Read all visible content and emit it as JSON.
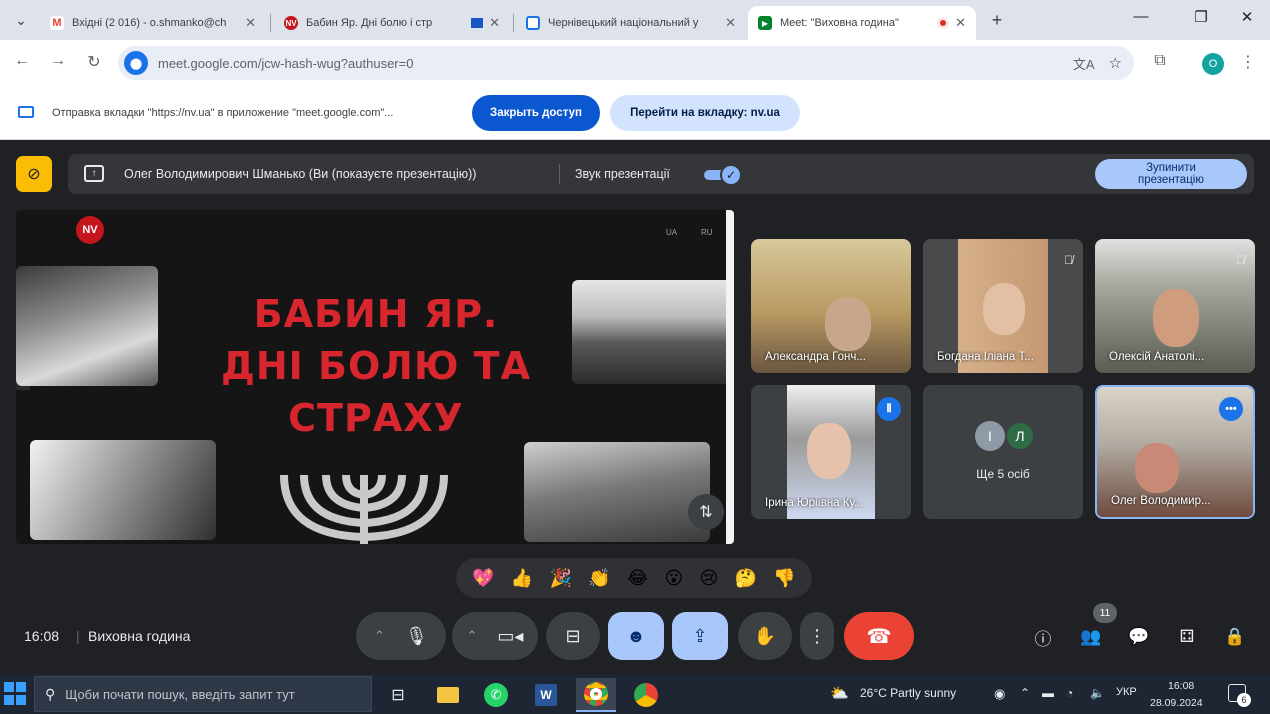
{
  "browser": {
    "tabs": [
      {
        "title": "Вхідні (2 016) - o.shmanko@ch",
        "favicon": "gmail-icon",
        "favicon_color": "#ea4335"
      },
      {
        "title": "Бабин Яр. Дні болю і стр",
        "favicon": "nv-icon",
        "favicon_color": "#c4161c"
      },
      {
        "title": "Чернівецький національний у",
        "favicon": "classroom-icon",
        "favicon_color": "#1a73e8"
      },
      {
        "title": "Meet: \"Виховна година\"",
        "favicon": "meet-icon",
        "favicon_color": "#00832d",
        "active": true
      }
    ],
    "new_tab": "+",
    "url": "meet.google.com/jcw-hash-wug?authuser=0",
    "profile_initial": "O"
  },
  "share_banner": {
    "message": "Отправка вкладки \"https://nv.ua\" в приложение \"meet.google.com\"...",
    "close_access": "Закрыть доступ",
    "goto_tab": "Перейти на вкладку: nv.ua"
  },
  "presentation_bar": {
    "presenter": "Олег Володимирович Шманько (Ви (показуєте презентацію))",
    "sound_label": "Звук презентації",
    "sound_on": true,
    "stop_line1": "Зупинити",
    "stop_line2": "презентацію"
  },
  "slide": {
    "logo": "NV",
    "lang_ua": "UA",
    "lang_ru": "RU",
    "headline_1": "БАБИН ЯР.",
    "headline_2": "ДНІ БОЛЮ ТА",
    "headline_3": "СТРАХУ"
  },
  "participants": [
    {
      "name": "Александра Гонч...",
      "muted": false,
      "bg": "#b89a62"
    },
    {
      "name": "Богдана Іліана Т...",
      "muted": true,
      "bg": "#c49873"
    },
    {
      "name": "Олексій Анатолі...",
      "muted": true,
      "bg": "#7d8278"
    },
    {
      "name": "Ірина Юріївна Ку...",
      "muted": false,
      "speaking": true,
      "bg": "#9a9a9a"
    },
    {
      "name": "Ще 5 осіб",
      "avatars": [
        "І",
        "Л"
      ],
      "avatar_colors": [
        "#8e9aa8",
        "#2f6b46"
      ]
    },
    {
      "name": "Олег Володимир...",
      "muted": false,
      "self": true,
      "bg": "#b0aaa1"
    }
  ],
  "reactions": [
    "💖",
    "👍",
    "🎉",
    "👏",
    "😂",
    "😮",
    "😢",
    "🤔",
    "👎"
  ],
  "bottom": {
    "time": "16:08",
    "separator": "|",
    "meeting_name": "Виховна година",
    "participant_count": "11"
  },
  "taskbar": {
    "search_placeholder": "Щоби почати пошук, введіть запит тут",
    "weather": "26°C  Partly sunny",
    "lang": "УКР",
    "time": "16:08",
    "date": "28.09.2024",
    "notifications": "6"
  }
}
